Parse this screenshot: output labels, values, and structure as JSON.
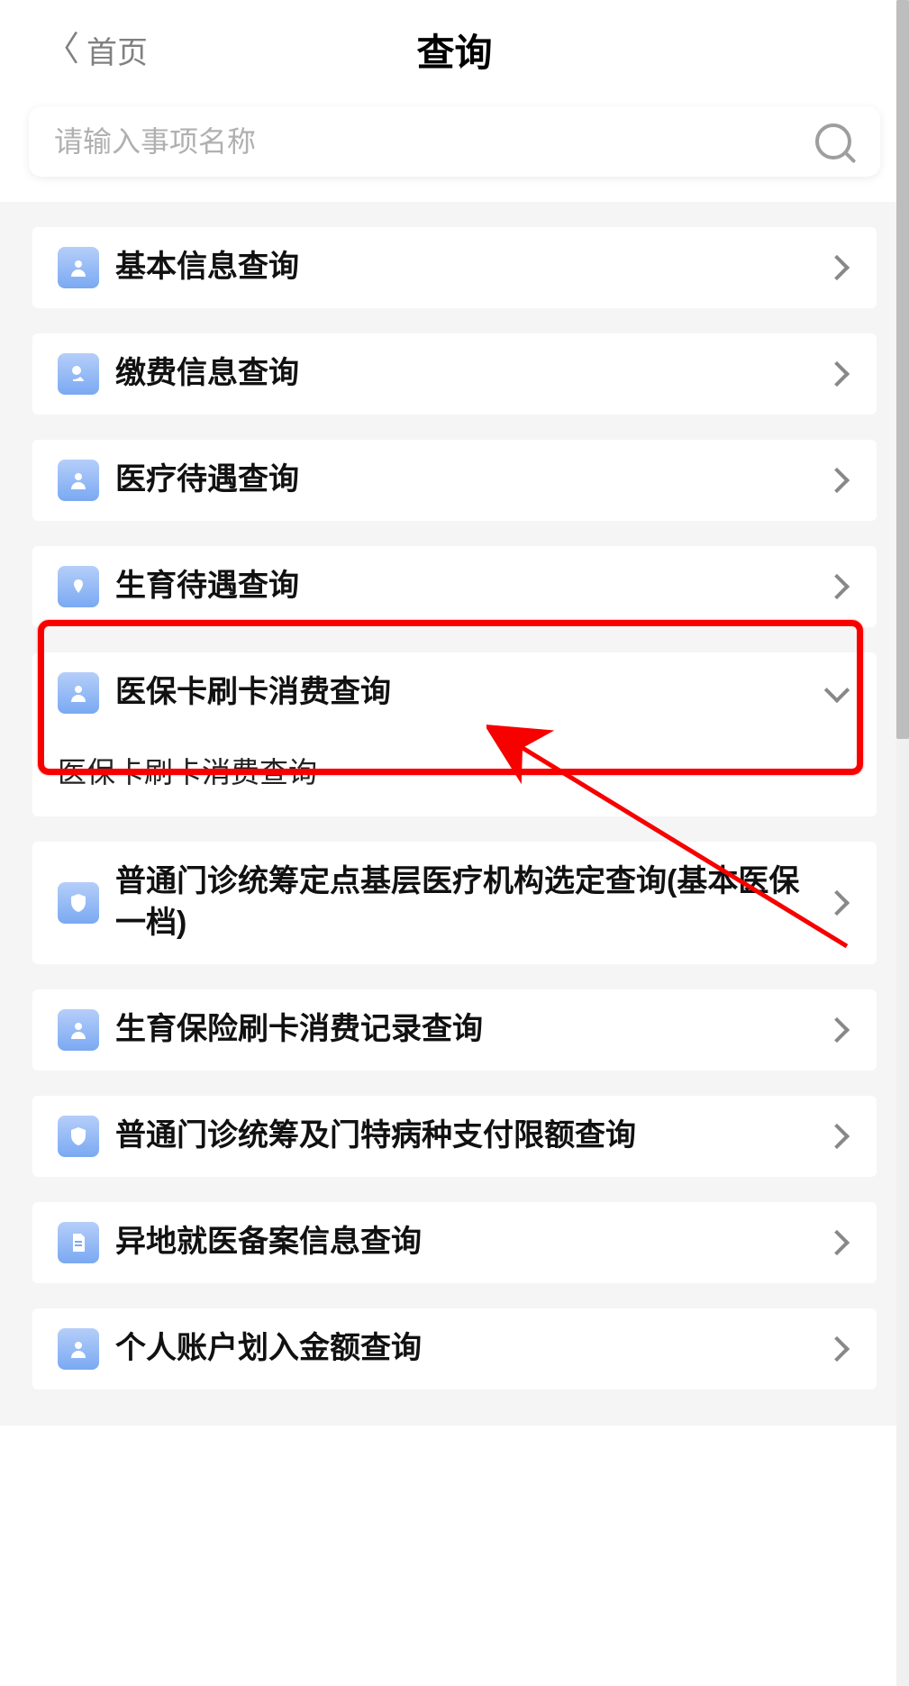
{
  "header": {
    "back_label": "首页",
    "title": "查询"
  },
  "search": {
    "placeholder": "请输入事项名称"
  },
  "items": [
    {
      "label": "基本信息查询",
      "icon": "person"
    },
    {
      "label": "缴费信息查询",
      "icon": "payment"
    },
    {
      "label": "医疗待遇查询",
      "icon": "person"
    },
    {
      "label": "生育待遇查询",
      "icon": "hands"
    },
    {
      "label": "医保卡刷卡消费查询",
      "icon": "person",
      "expanded": true,
      "sub": "医保卡刷卡消费查询"
    },
    {
      "label": "普通门诊统筹定点基层医疗机构选定查询(基本医保一档)",
      "icon": "shield"
    },
    {
      "label": "生育保险刷卡消费记录查询",
      "icon": "person"
    },
    {
      "label": "普通门诊统筹及门特病种支付限额查询",
      "icon": "shield"
    },
    {
      "label": "异地就医备案信息查询",
      "icon": "doc"
    },
    {
      "label": "个人账户划入金额查询",
      "icon": "person"
    }
  ],
  "annotation": {
    "highlight_color": "#f70000"
  }
}
